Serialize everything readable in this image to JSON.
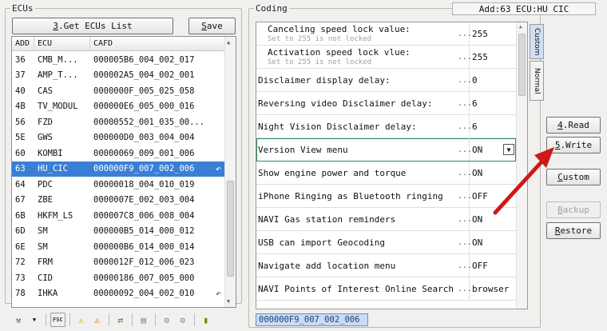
{
  "ecus": {
    "title": "ECUs",
    "get_list_label": "3.Get ECUs List",
    "get_list_hotkey": "3",
    "get_list_rest": ".Get ECUs List",
    "save_label": "Save",
    "save_hotkey": "S",
    "save_rest": "ave",
    "columns": [
      "ADD",
      "ECU",
      "CAFD"
    ],
    "rows": [
      {
        "add": "36",
        "ecu": "CMB_M...",
        "cafd": "000005B6_004_002_017"
      },
      {
        "add": "37",
        "ecu": "AMP_T...",
        "cafd": "000002A5_004_002_001"
      },
      {
        "add": "40",
        "ecu": "CAS",
        "cafd": "0000000F_005_025_058"
      },
      {
        "add": "4B",
        "ecu": "TV_MODUL",
        "cafd": "000000E6_005_000_016"
      },
      {
        "add": "56",
        "ecu": "FZD",
        "cafd": "00000552_001_035_00..."
      },
      {
        "add": "5E",
        "ecu": "GWS",
        "cafd": "000000D0_003_004_004"
      },
      {
        "add": "60",
        "ecu": "KOMBI",
        "cafd": "00000069_009_001_006"
      },
      {
        "add": "63",
        "ecu": "HU_CIC",
        "cafd": "000000F9_007_002_006"
      },
      {
        "add": "64",
        "ecu": "PDC",
        "cafd": "00000018_004_010_019"
      },
      {
        "add": "67",
        "ecu": "ZBE",
        "cafd": "0000007E_002_003_004"
      },
      {
        "add": "6B",
        "ecu": "HKFM_LS",
        "cafd": "000007C8_006_008_004"
      },
      {
        "add": "6D",
        "ecu": "SM",
        "cafd": "000000B5_014_000_012"
      },
      {
        "add": "6E",
        "ecu": "SM",
        "cafd": "000000B6_014_000_014"
      },
      {
        "add": "72",
        "ecu": "FRM",
        "cafd": "0000012F_012_006_023"
      },
      {
        "add": "73",
        "ecu": "CID",
        "cafd": "00000186_007_005_000"
      },
      {
        "add": "78",
        "ecu": "IHKA",
        "cafd": "00000092_004_002_010"
      }
    ],
    "toolbar": {
      "fsc": "FSC"
    }
  },
  "coding": {
    "title": "Coding",
    "address": "Add:63 ECU:HU CIC",
    "dots": "...",
    "rows": [
      {
        "name": "Canceling speed lock value:",
        "sub": "Set to 255 is not locked",
        "value": "255"
      },
      {
        "name": "Activation speed lock vlue:",
        "sub": "Set to 255 is not locked",
        "value": "255"
      },
      {
        "name": "Disclaimer display delay:",
        "value": "0"
      },
      {
        "name": "Reversing video Disclaimer delay:",
        "value": "6"
      },
      {
        "name": "Night Vision Disclaimer delay:",
        "value": "6"
      },
      {
        "name": "Version View menu",
        "value": "ON"
      },
      {
        "name": "Show engine power and torque",
        "value": "ON"
      },
      {
        "name": "iPhone Ringing as Bluetooth ringing",
        "value": "OFF"
      },
      {
        "name": "NAVI Gas station reminders",
        "value": "ON"
      },
      {
        "name": "USB can import Geocoding",
        "value": "ON"
      },
      {
        "name": "Navigate add location menu",
        "value": "OFF"
      },
      {
        "name": "NAVI Points of Interest Online Search",
        "value": "browser"
      }
    ],
    "tabs": {
      "custom": "Custom",
      "normal": "Normal"
    },
    "bottom_tab": "000000F9_007_002_006"
  },
  "actions": {
    "read": {
      "hotkey": "4",
      "rest": ".Read"
    },
    "write": {
      "hotkey": "5",
      "rest": ".Write"
    },
    "custom": {
      "hotkey": "C",
      "rest": "ustom"
    },
    "backup": {
      "hotkey": "B",
      "rest": "ackup"
    },
    "restore": {
      "hotkey": "R",
      "rest": "estore"
    }
  },
  "colors": {
    "selection": "#3a7fd5",
    "arrow": "#d01818",
    "active_outline": "#2e8b57"
  }
}
